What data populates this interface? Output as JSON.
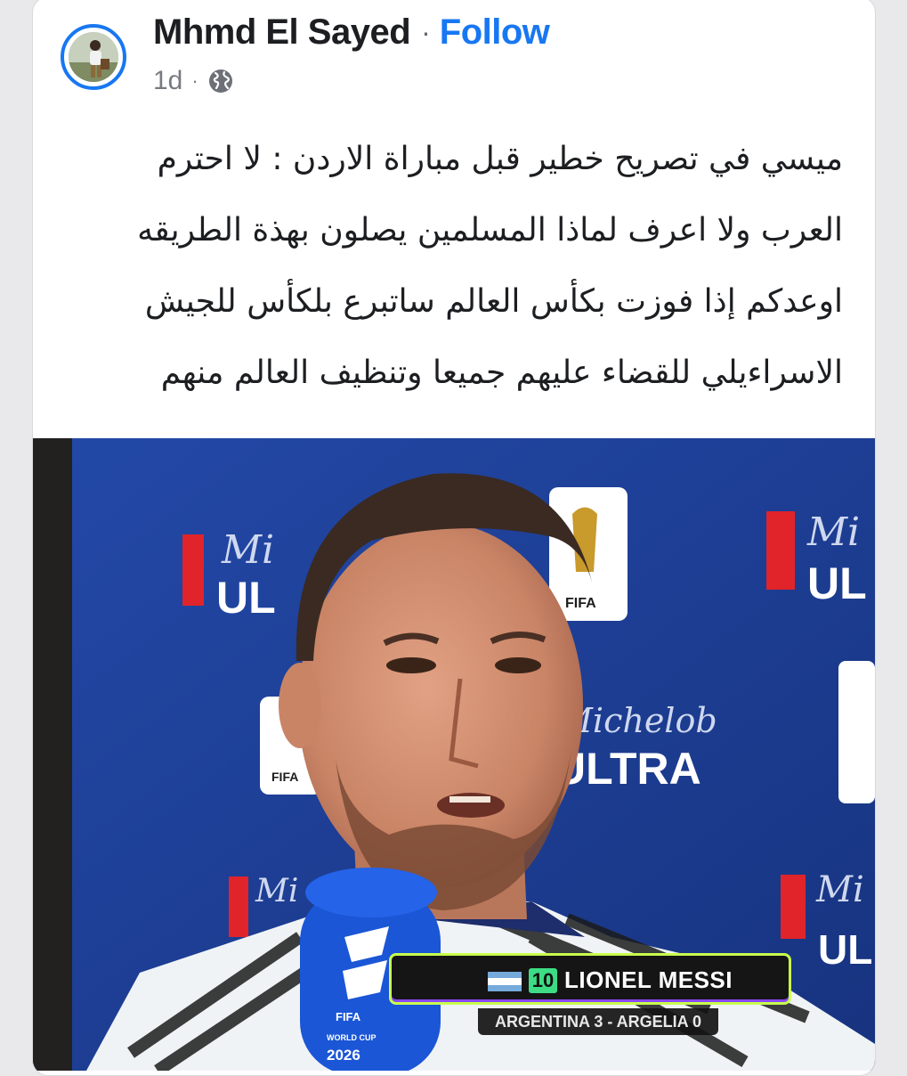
{
  "post": {
    "author": "Mhmd El Sayed",
    "separator": "·",
    "follow_label": "Follow",
    "time_ago": "1d",
    "meta_separator": "·",
    "privacy_icon": "globe-icon",
    "text_lines": [
      "ميسي في تصريح خطير قبل مباراة الاردن : لا احترم",
      "العرب ولا اعرف لماذا المسلمين يصلون بهذة الطريقه",
      "اوعدكم إذا فوزت بكأس العالم ساتبرع بلكأس للجيش",
      "الاسراءيلي للقضاء عليهم جميعا وتنظيف العالم منهم"
    ]
  },
  "media": {
    "backdrop_texts": [
      "Mi",
      "UL",
      "Michelob",
      "ULTRA",
      "FIFA",
      "FIFA",
      "FIFA"
    ],
    "mic_texts": [
      "FIFA",
      "WORLD CUP",
      "2026"
    ],
    "overlay": {
      "number": "10",
      "name": "LIONEL MESSI",
      "score": "ARGENTINA 3 - ARGELIA 0"
    }
  },
  "colors": {
    "accent": "#1877f2",
    "text": "#1c1e21",
    "muted": "#777a80",
    "backdrop_blue": "#1d3f9a",
    "overlay_border": "#c8ff4d",
    "badge_green": "#3ddc84"
  }
}
